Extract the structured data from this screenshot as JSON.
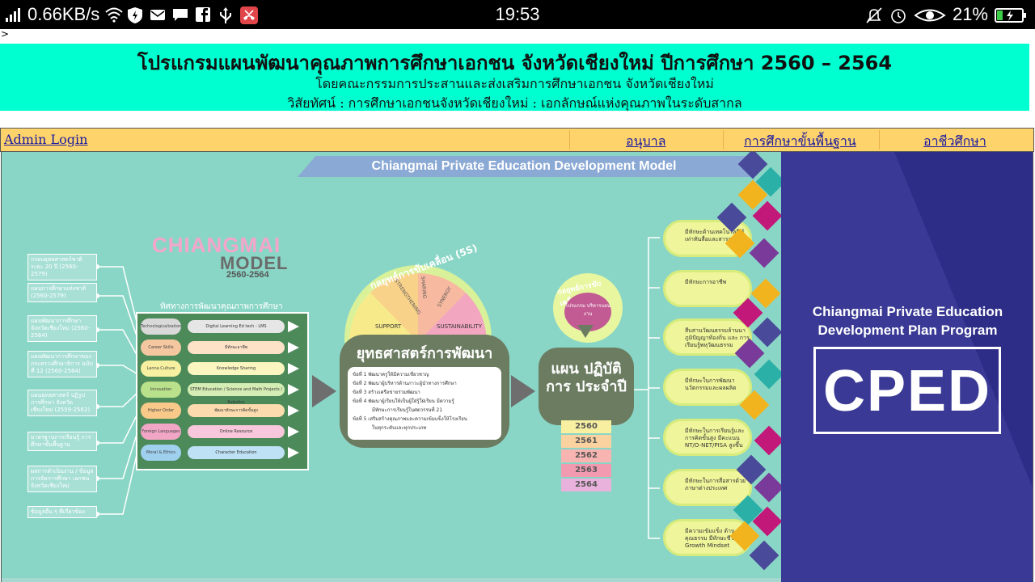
{
  "status_bar": {
    "speed": "0.66KB/s",
    "time": "19:53",
    "battery": "21%",
    "icons_left": [
      "signal-icon",
      "wifi-icon",
      "shield-icon",
      "mail-icon",
      "chat-icon",
      "facebook-icon",
      "usb-icon",
      "missed-call-icon"
    ],
    "icons_right": [
      "mute-icon",
      "alarm-icon",
      "eye-icon",
      "battery-charging-icon"
    ]
  },
  "caret": ">",
  "header": {
    "title": "โปรแกรมแผนพัฒนาคุณภาพการศึกษาเอกชน จังหวัดเชียงใหม่ ปีการศึกษา 2560 – 2564",
    "subtitle": "โดยคณะกรรมการประสานและส่งเสริมการศึกษาเอกชน จังหวัดเชียงใหม่",
    "vision": "วิสัยทัศน์ : การศึกษาเอกชนจังหวัดเชียงใหม่ : เอกลักษณ์แห่งคุณภาพในระดับสากล",
    "bg_color": "#00ffd0"
  },
  "nav": {
    "admin": "Admin Login",
    "kindergarten": "อนุบาล",
    "basic": "การศึกษาขั้นพื้นฐาน",
    "vocational": "อาชีวศึกษา",
    "bg_color": "#ffd36b"
  },
  "banner": {
    "model_title": "Chiangmai Private Education Development Model",
    "cm_title": "CHIANGMAI",
    "cm_model": "MODEL",
    "cm_years": "2560-2564",
    "left_items": [
      "กรอบยุทธศาสตร์ชาติ ระยะ 20 ปี (2560-2579)",
      "แผนการศึกษาแห่งชาติ (2560-2579)",
      "แผนพัฒนาการศึกษา จังหวัดเชียงใหม่ (2560-2564)",
      "แผนพัฒนาการศึกษาของ กระทรวงศึกษาธิการ ฉบับที่ 12 (2560-2564)",
      "แผนยุทธศาสตร์ ปฏิรูปการศึกษา จังหวัดเชียงใหม่ (2559-2562)",
      "มาตรฐานการเรียนรู้ การศึกษาขั้นพื้นฐาน",
      "ผลการดำเนินงาน / ข้อมูลการจัดการศึกษา เอกชน จังหวัดเชียงใหม่",
      "ข้อมูลอื่น ๆ ที่เกี่ยวข้อง"
    ],
    "direction_title": "ทิศทางการพัฒนาคุณภาพการศึกษา",
    "directions": [
      {
        "chip": "Technologicalization",
        "bar": "Digital Learning  Ed tech - LMS",
        "chip_color": "#d9d9d9",
        "bar_color": "#e6e6e6"
      },
      {
        "chip": "Career Skills",
        "bar": "มีทักษะอาชีพ",
        "chip_color": "#f4c7a0",
        "bar_color": "#fde2c8"
      },
      {
        "chip": "Lanna Culture",
        "bar": "Knowledge Sharing",
        "chip_color": "#f6f0a0",
        "bar_color": "#fbf6c0"
      },
      {
        "chip": "Innovation",
        "bar": "STEM Education / Science and Math Projects / Robotics",
        "chip_color": "#b9e08a",
        "bar_color": "#d4edb4"
      },
      {
        "chip": "Higher Order Thinking Skills",
        "bar": "พัฒนาทักษะการคิดขั้นสูง",
        "chip_color": "#f9c98a",
        "bar_color": "#fcdcae"
      },
      {
        "chip": "Foreign Languages",
        "bar": "Online Resource",
        "chip_color": "#f2a6c6",
        "bar_color": "#f8c7db"
      },
      {
        "chip": "Moral & Ethics",
        "bar": "Character Education",
        "chip_color": "#9fd0ee",
        "bar_color": "#bfe1f5"
      }
    ],
    "strategy_arc": "กลยุทธ์การขับเคลื่อน (5S)",
    "arc_words": [
      "SUPPORT",
      "STRENGTHENING",
      "SHARING",
      "SYNERGY",
      "SUSTAINABILITY"
    ],
    "strategy_title": "ยุทธศาสตร์การพัฒนา",
    "strategies": [
      "ข้อที่ 1 พัฒนาครูให้มีความเชี่ยวชาญ",
      "ข้อที่ 2 พัฒนาผู้บริหารด้านภาวะผู้นำทางการศึกษา",
      "ข้อที่ 3 สร้างเครือข่ายร่วมพัฒนา",
      "ข้อที่ 4 พัฒนาผู้เรียนให้เป็นผู้ใฝ่รู้ใฝ่เรียน มีความรู้",
      "มีทักษะการเรียนรู้ในศตวรรษที่ 21",
      "ข้อที่ 5 เสริมสร้างคุณภาพและความเข้มแข็งให้โรงเรียน",
      "ในทุกระดับและทุกประเภท"
    ],
    "plan_arc": "กลยุทธ์การขับเคลื่อน",
    "plan_inner": "โปรแกรม บริหารแผนงาน",
    "plan_title": "แผน ปฏิบัติการ ประจำปี",
    "years": [
      "2560",
      "2561",
      "2562",
      "2563",
      "2564"
    ],
    "year_colors": [
      "#f8f0a0",
      "#f9d2a0",
      "#f7b4b0",
      "#f29ab0",
      "#e9b2dc"
    ],
    "outcomes": [
      "มีทักษะด้านเทคโนโลยี รู้เท่าทันสื่อและสารสนเทศ",
      "มีทักษะการอาชีพ",
      "สืบสานวัฒนธรรมล้านนา ภูมิปัญญาท้องถิ่น และ การเรียนรู้พหุวัฒนธรรม",
      "มีทักษะในการพัฒนา นวัตกรรมและผลผลิต",
      "มีทักษะในการเรียนรู้และ การคิดขั้นสูง มีคะแนน NT/O-NET/PISA สูงขึ้น",
      "มีทักษะในการสื่อสารด้วย ภาษาต่างประเทศ",
      "มีความเข้มแข็ง ด้านคุณธรรม มีทักษะชีวิต และ Growth Mindset"
    ],
    "program_title_1": "Chiangmai Private Education",
    "program_title_2": "Development Plan Program",
    "cped": "CPED"
  }
}
